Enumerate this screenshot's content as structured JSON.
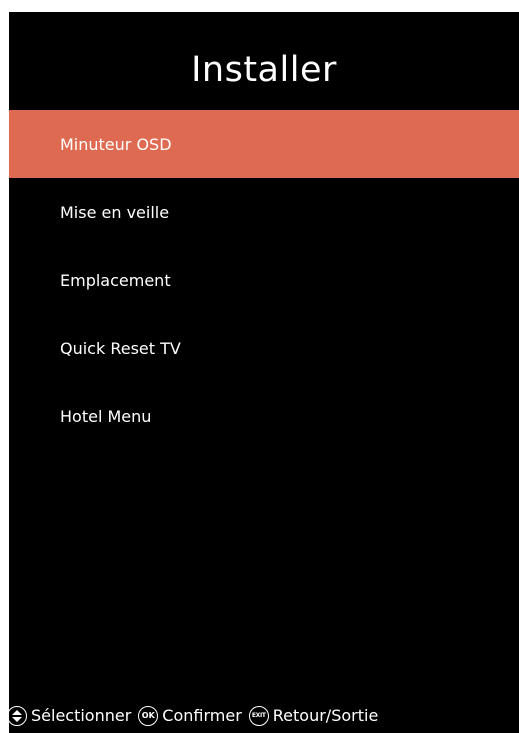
{
  "title": "Installer",
  "menu": {
    "items": [
      {
        "label": "Minuteur OSD",
        "selected": true
      },
      {
        "label": "Mise en veille",
        "selected": false
      },
      {
        "label": "Emplacement",
        "selected": false
      },
      {
        "label": "Quick Reset TV",
        "selected": false
      },
      {
        "label": "Hotel Menu",
        "selected": false
      }
    ]
  },
  "footer": {
    "select": {
      "icon": "up-down-icon",
      "label": "Sélectionner"
    },
    "confirm": {
      "icon": "ok-icon",
      "icon_text": "OK",
      "label": "Confirmer"
    },
    "exit": {
      "icon": "exit-icon",
      "icon_text": "EXIT",
      "label": "Retour/Sortie"
    }
  },
  "colors": {
    "background": "#000000",
    "highlight": "#df6a52",
    "text": "#ffffff"
  }
}
